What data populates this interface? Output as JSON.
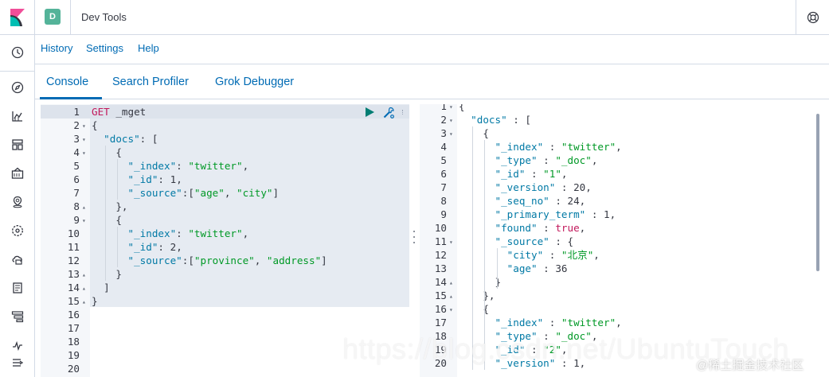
{
  "header": {
    "space_initial": "D",
    "app_title": "Dev Tools"
  },
  "menu": {
    "items": [
      "History",
      "Settings",
      "Help"
    ]
  },
  "tabs": {
    "items": [
      "Console",
      "Search Profiler",
      "Grok Debugger"
    ],
    "active": "Console"
  },
  "request_editor": {
    "lines": [
      {
        "n": "1",
        "fold": "",
        "tokens": [
          [
            "method",
            "GET "
          ],
          [
            "punc",
            "_mget"
          ]
        ]
      },
      {
        "n": "2",
        "fold": "▾",
        "tokens": [
          [
            "punc",
            "{"
          ]
        ]
      },
      {
        "n": "3",
        "fold": "▾",
        "tokens": [
          [
            "punc",
            "  "
          ],
          [
            "key",
            "\"docs\""
          ],
          [
            "punc",
            ": ["
          ]
        ]
      },
      {
        "n": "4",
        "fold": "▾",
        "tokens": [
          [
            "punc",
            "    {"
          ]
        ]
      },
      {
        "n": "5",
        "fold": "",
        "tokens": [
          [
            "punc",
            "      "
          ],
          [
            "key",
            "\"_index\""
          ],
          [
            "punc",
            ": "
          ],
          [
            "str",
            "\"twitter\""
          ],
          [
            "punc",
            ","
          ]
        ]
      },
      {
        "n": "6",
        "fold": "",
        "tokens": [
          [
            "punc",
            "      "
          ],
          [
            "key",
            "\"_id\""
          ],
          [
            "punc",
            ": "
          ],
          [
            "num",
            "1"
          ],
          [
            "punc",
            ","
          ]
        ]
      },
      {
        "n": "7",
        "fold": "",
        "tokens": [
          [
            "punc",
            "      "
          ],
          [
            "key",
            "\"_source\""
          ],
          [
            "punc",
            ":["
          ],
          [
            "str",
            "\"age\""
          ],
          [
            "punc",
            ", "
          ],
          [
            "str",
            "\"city\""
          ],
          [
            "punc",
            "]"
          ]
        ]
      },
      {
        "n": "8",
        "fold": "▴",
        "tokens": [
          [
            "punc",
            "    },"
          ]
        ]
      },
      {
        "n": "9",
        "fold": "▾",
        "tokens": [
          [
            "punc",
            "    {"
          ]
        ]
      },
      {
        "n": "10",
        "fold": "",
        "tokens": [
          [
            "punc",
            "      "
          ],
          [
            "key",
            "\"_index\""
          ],
          [
            "punc",
            ": "
          ],
          [
            "str",
            "\"twitter\""
          ],
          [
            "punc",
            ","
          ]
        ]
      },
      {
        "n": "11",
        "fold": "",
        "tokens": [
          [
            "punc",
            "      "
          ],
          [
            "key",
            "\"_id\""
          ],
          [
            "punc",
            ": "
          ],
          [
            "num",
            "2"
          ],
          [
            "punc",
            ","
          ]
        ]
      },
      {
        "n": "12",
        "fold": "",
        "tokens": [
          [
            "punc",
            "      "
          ],
          [
            "key",
            "\"_source\""
          ],
          [
            "punc",
            ":["
          ],
          [
            "str",
            "\"province\""
          ],
          [
            "punc",
            ", "
          ],
          [
            "str",
            "\"address\""
          ],
          [
            "punc",
            "]"
          ]
        ]
      },
      {
        "n": "13",
        "fold": "▴",
        "tokens": [
          [
            "punc",
            "    }"
          ]
        ]
      },
      {
        "n": "14",
        "fold": "▴",
        "tokens": [
          [
            "punc",
            "  ]"
          ]
        ]
      },
      {
        "n": "15",
        "fold": "▴",
        "tokens": [
          [
            "punc",
            "}"
          ]
        ]
      },
      {
        "n": "16",
        "fold": "",
        "tokens": []
      },
      {
        "n": "17",
        "fold": "",
        "tokens": []
      },
      {
        "n": "18",
        "fold": "",
        "tokens": []
      },
      {
        "n": "19",
        "fold": "",
        "tokens": []
      },
      {
        "n": "20",
        "fold": "",
        "tokens": []
      }
    ]
  },
  "response_editor": {
    "lines": [
      {
        "n": "1",
        "fold": "▾",
        "tokens": [
          [
            "punc",
            "{"
          ]
        ]
      },
      {
        "n": "2",
        "fold": "▾",
        "tokens": [
          [
            "punc",
            "  "
          ],
          [
            "key",
            "\"docs\""
          ],
          [
            "punc",
            " : ["
          ]
        ]
      },
      {
        "n": "3",
        "fold": "▾",
        "tokens": [
          [
            "punc",
            "    {"
          ]
        ]
      },
      {
        "n": "4",
        "fold": "",
        "tokens": [
          [
            "punc",
            "      "
          ],
          [
            "key",
            "\"_index\""
          ],
          [
            "punc",
            " : "
          ],
          [
            "str",
            "\"twitter\""
          ],
          [
            "punc",
            ","
          ]
        ]
      },
      {
        "n": "5",
        "fold": "",
        "tokens": [
          [
            "punc",
            "      "
          ],
          [
            "key",
            "\"_type\""
          ],
          [
            "punc",
            " : "
          ],
          [
            "str",
            "\"_doc\""
          ],
          [
            "punc",
            ","
          ]
        ]
      },
      {
        "n": "6",
        "fold": "",
        "tokens": [
          [
            "punc",
            "      "
          ],
          [
            "key",
            "\"_id\""
          ],
          [
            "punc",
            " : "
          ],
          [
            "str",
            "\"1\""
          ],
          [
            "punc",
            ","
          ]
        ]
      },
      {
        "n": "7",
        "fold": "",
        "tokens": [
          [
            "punc",
            "      "
          ],
          [
            "key",
            "\"_version\""
          ],
          [
            "punc",
            " : "
          ],
          [
            "num",
            "20"
          ],
          [
            "punc",
            ","
          ]
        ]
      },
      {
        "n": "8",
        "fold": "",
        "tokens": [
          [
            "punc",
            "      "
          ],
          [
            "key",
            "\"_seq_no\""
          ],
          [
            "punc",
            " : "
          ],
          [
            "num",
            "24"
          ],
          [
            "punc",
            ","
          ]
        ]
      },
      {
        "n": "9",
        "fold": "",
        "tokens": [
          [
            "punc",
            "      "
          ],
          [
            "key",
            "\"_primary_term\""
          ],
          [
            "punc",
            " : "
          ],
          [
            "num",
            "1"
          ],
          [
            "punc",
            ","
          ]
        ]
      },
      {
        "n": "10",
        "fold": "",
        "tokens": [
          [
            "punc",
            "      "
          ],
          [
            "key",
            "\"found\""
          ],
          [
            "punc",
            " : "
          ],
          [
            "bool",
            "true"
          ],
          [
            "punc",
            ","
          ]
        ]
      },
      {
        "n": "11",
        "fold": "▾",
        "tokens": [
          [
            "punc",
            "      "
          ],
          [
            "key",
            "\"_source\""
          ],
          [
            "punc",
            " : {"
          ]
        ]
      },
      {
        "n": "12",
        "fold": "",
        "tokens": [
          [
            "punc",
            "        "
          ],
          [
            "key",
            "\"city\""
          ],
          [
            "punc",
            " : "
          ],
          [
            "str",
            "\"北京\""
          ],
          [
            "punc",
            ","
          ]
        ]
      },
      {
        "n": "13",
        "fold": "",
        "tokens": [
          [
            "punc",
            "        "
          ],
          [
            "key",
            "\"age\""
          ],
          [
            "punc",
            " : "
          ],
          [
            "num",
            "36"
          ]
        ]
      },
      {
        "n": "14",
        "fold": "▴",
        "tokens": [
          [
            "punc",
            "      }"
          ]
        ]
      },
      {
        "n": "15",
        "fold": "▴",
        "tokens": [
          [
            "punc",
            "    },"
          ]
        ]
      },
      {
        "n": "16",
        "fold": "▾",
        "tokens": [
          [
            "punc",
            "    {"
          ]
        ]
      },
      {
        "n": "17",
        "fold": "",
        "tokens": [
          [
            "punc",
            "      "
          ],
          [
            "key",
            "\"_index\""
          ],
          [
            "punc",
            " : "
          ],
          [
            "str",
            "\"twitter\""
          ],
          [
            "punc",
            ","
          ]
        ]
      },
      {
        "n": "18",
        "fold": "",
        "tokens": [
          [
            "punc",
            "      "
          ],
          [
            "key",
            "\"_type\""
          ],
          [
            "punc",
            " : "
          ],
          [
            "str",
            "\"_doc\""
          ],
          [
            "punc",
            ","
          ]
        ]
      },
      {
        "n": "19",
        "fold": "",
        "tokens": [
          [
            "punc",
            "      "
          ],
          [
            "key",
            "\"_id\""
          ],
          [
            "punc",
            " : "
          ],
          [
            "str",
            "\"2\""
          ],
          [
            "punc",
            ","
          ]
        ]
      },
      {
        "n": "20",
        "fold": "",
        "tokens": [
          [
            "punc",
            "      "
          ],
          [
            "key",
            "\"_version\""
          ],
          [
            "punc",
            " : "
          ],
          [
            "num",
            "1"
          ],
          [
            "punc",
            ","
          ]
        ]
      }
    ]
  },
  "watermark": {
    "url": "https://blog.csdn.net/UbuntuTouch",
    "site": "@稀土掘金技术社区"
  },
  "colors": {
    "accent": "#006bb4",
    "space_badge": "#54b399",
    "string": "#009926",
    "key": "#0079a5",
    "method": "#c2185b"
  },
  "icons": [
    "kibana-logo-icon",
    "help-globe-icon",
    "clock-icon",
    "discover-icon",
    "visualize-icon",
    "dashboard-icon",
    "canvas-icon",
    "maps-icon",
    "ml-icon",
    "infrastructure-icon",
    "logs-icon",
    "apm-icon",
    "uptime-icon",
    "dock-toggle-icon",
    "play-icon",
    "wrench-icon"
  ]
}
